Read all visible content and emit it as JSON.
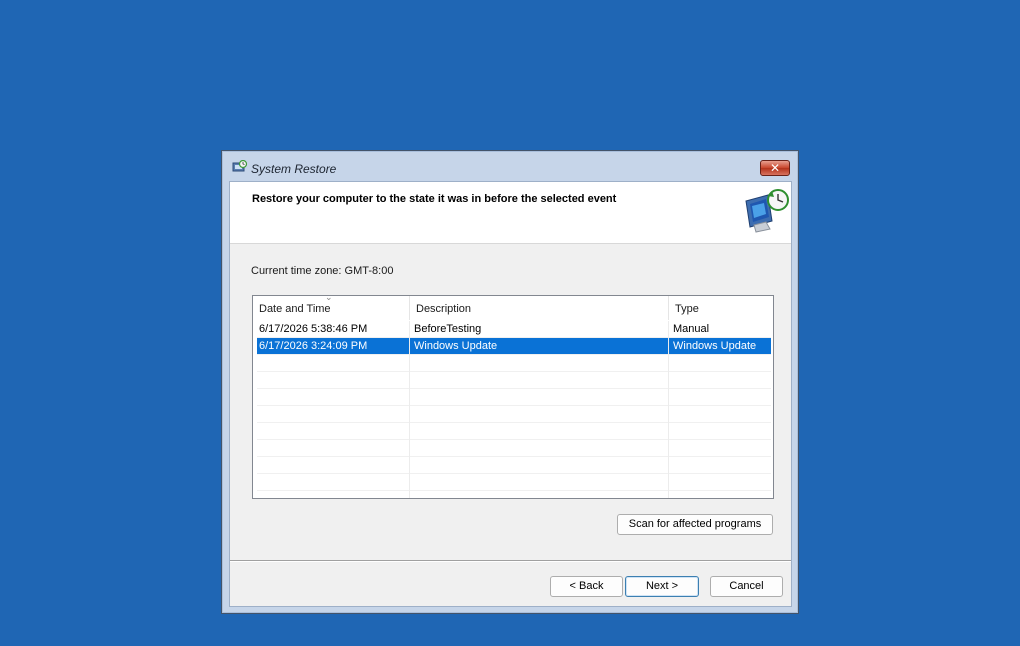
{
  "window": {
    "title": "System Restore",
    "close_label": "✕"
  },
  "header": {
    "text": "Restore your computer to the state it was in before the selected event"
  },
  "timezone": "Current time zone: GMT-8:00",
  "table": {
    "columns": [
      "Date and Time",
      "Description",
      "Type"
    ],
    "sort_indicator": "⌄",
    "rows": [
      {
        "date": "6/17/2026 5:38:46 PM",
        "description": "BeforeTesting",
        "type": "Manual",
        "selected": false
      },
      {
        "date": "6/17/2026 3:24:09 PM",
        "description": "Windows Update",
        "type": "Windows Update",
        "selected": true
      }
    ]
  },
  "buttons": {
    "scan": "Scan for affected programs",
    "back": "< Back",
    "next": "Next >",
    "cancel": "Cancel"
  },
  "colors": {
    "desktop": "#1f66b4",
    "selection": "#0a72d6"
  },
  "icons": {
    "title": "system-restore-icon",
    "header": "restore-monitor-clock-icon"
  }
}
